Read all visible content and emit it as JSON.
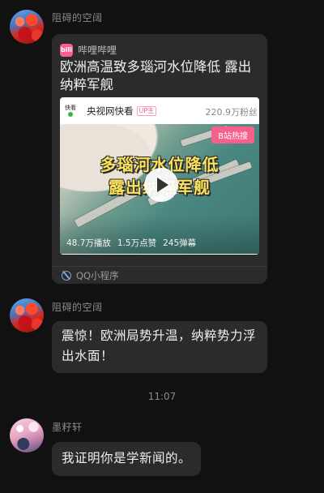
{
  "messages": [
    {
      "sender": "阻碍的空阔",
      "card": {
        "app_name": "哔哩哔哩",
        "title": "欧洲高温致多瑙河水位降低 露出纳粹军舰",
        "video": {
          "channel_logo": "快看",
          "channel": "央视网快看",
          "badge": "UP主",
          "fans": "220.9万粉丝",
          "hot_tag": "B站热搜",
          "overlay_line1": "多瑙河水位降低",
          "overlay_line2": "露出纳粹军舰",
          "plays": "48.7万播放",
          "likes": "1.5万点赞",
          "danmaku": "245弹幕"
        },
        "footer": "QQ小程序"
      }
    },
    {
      "sender": "阻碍的空阔",
      "text": "震惊！欧洲局势升温，纳粹势力浮出水面！"
    },
    {
      "sender": "墨籽轩",
      "text": "我证明你是学新闻的。"
    }
  ],
  "timestamp": "11:07",
  "colors": {
    "background": "#111111",
    "bubble": "#2b2b2b",
    "bilibili_pink": "#f8608c"
  }
}
